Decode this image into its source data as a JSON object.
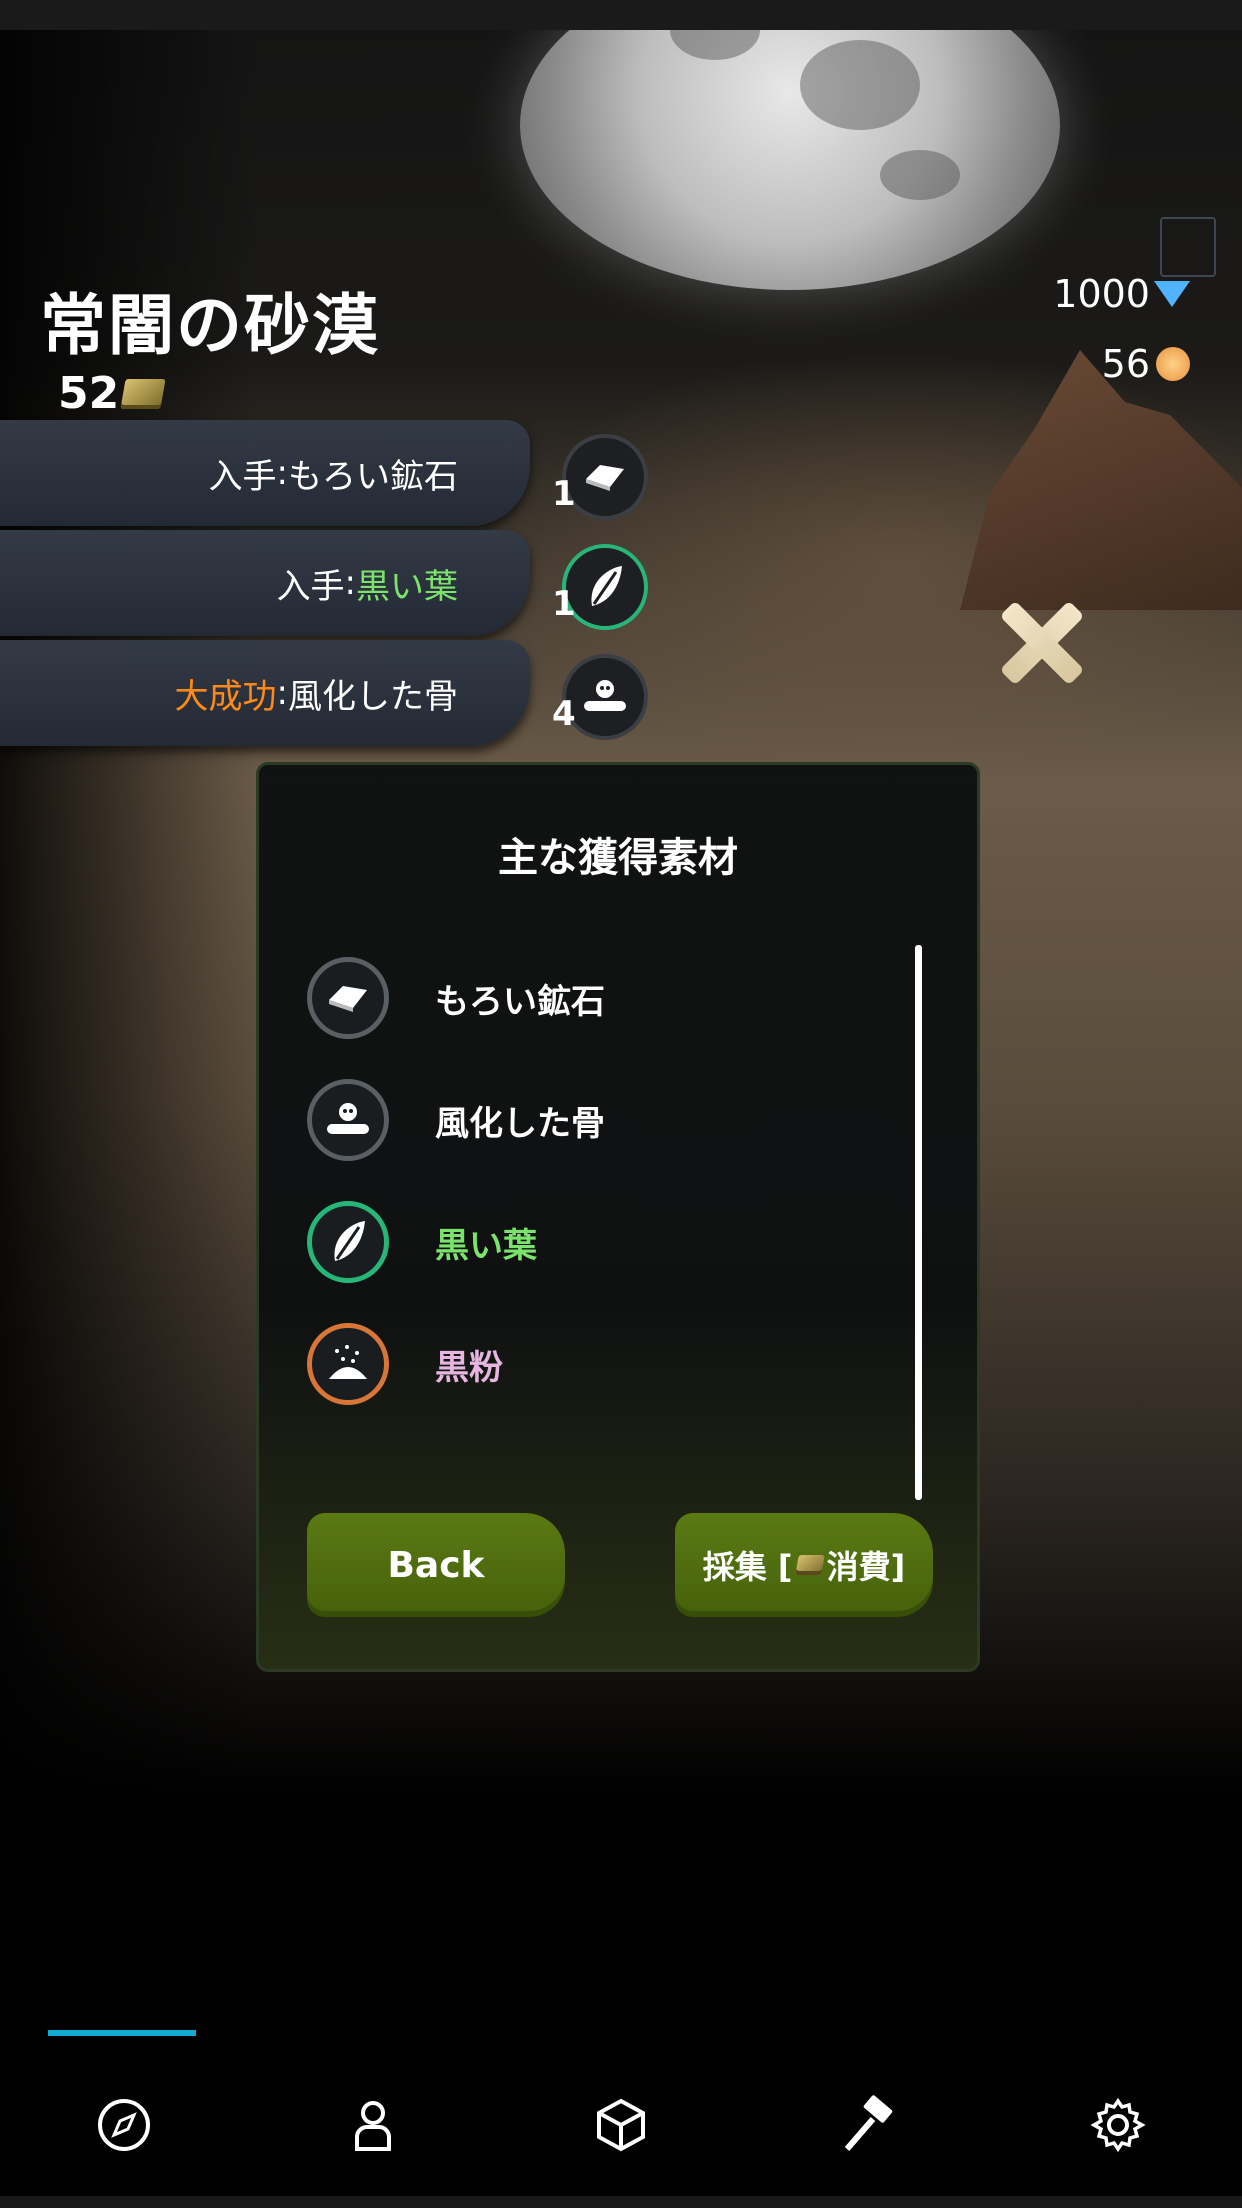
{
  "header": {
    "area_title": "常闇の砂漠",
    "stamina": "52",
    "gems": "1000",
    "coins": "56"
  },
  "log": [
    {
      "prefix": "入手",
      "sep": ":",
      "item": "もろい鉱石",
      "prefix_color": "#ffffff",
      "item_color": "#ffffff",
      "count": "1",
      "icon": "ore-icon"
    },
    {
      "prefix": "入手",
      "sep": ":",
      "item": "黒い葉",
      "prefix_color": "#ffffff",
      "item_color": "#7be36b",
      "count": "1",
      "icon": "leaf-icon"
    },
    {
      "prefix": "大成功",
      "sep": ":",
      "item": "風化した骨",
      "prefix_color": "#ff8a16",
      "item_color": "#ffffff",
      "count": "4",
      "icon": "bone-icon"
    }
  ],
  "panel": {
    "title": "主な獲得素材",
    "materials": [
      {
        "label": "もろい鉱石",
        "color": "#ffffff",
        "icon": "ore-icon"
      },
      {
        "label": "風化した骨",
        "color": "#ffffff",
        "icon": "bone-icon"
      },
      {
        "label": "黒い葉",
        "color": "#7be36b",
        "icon": "leaf-icon"
      },
      {
        "label": "黒粉",
        "color": "#e6b6e0",
        "icon": "powder-icon"
      }
    ],
    "back_label": "Back",
    "gather_prefix": "採集 [",
    "gather_suffix": "消費]"
  },
  "nav": {
    "items": [
      "compass-icon",
      "person-icon",
      "box-icon",
      "hammer-icon",
      "gear-icon"
    ],
    "active_index": 0,
    "accent": "#14a9d3"
  }
}
